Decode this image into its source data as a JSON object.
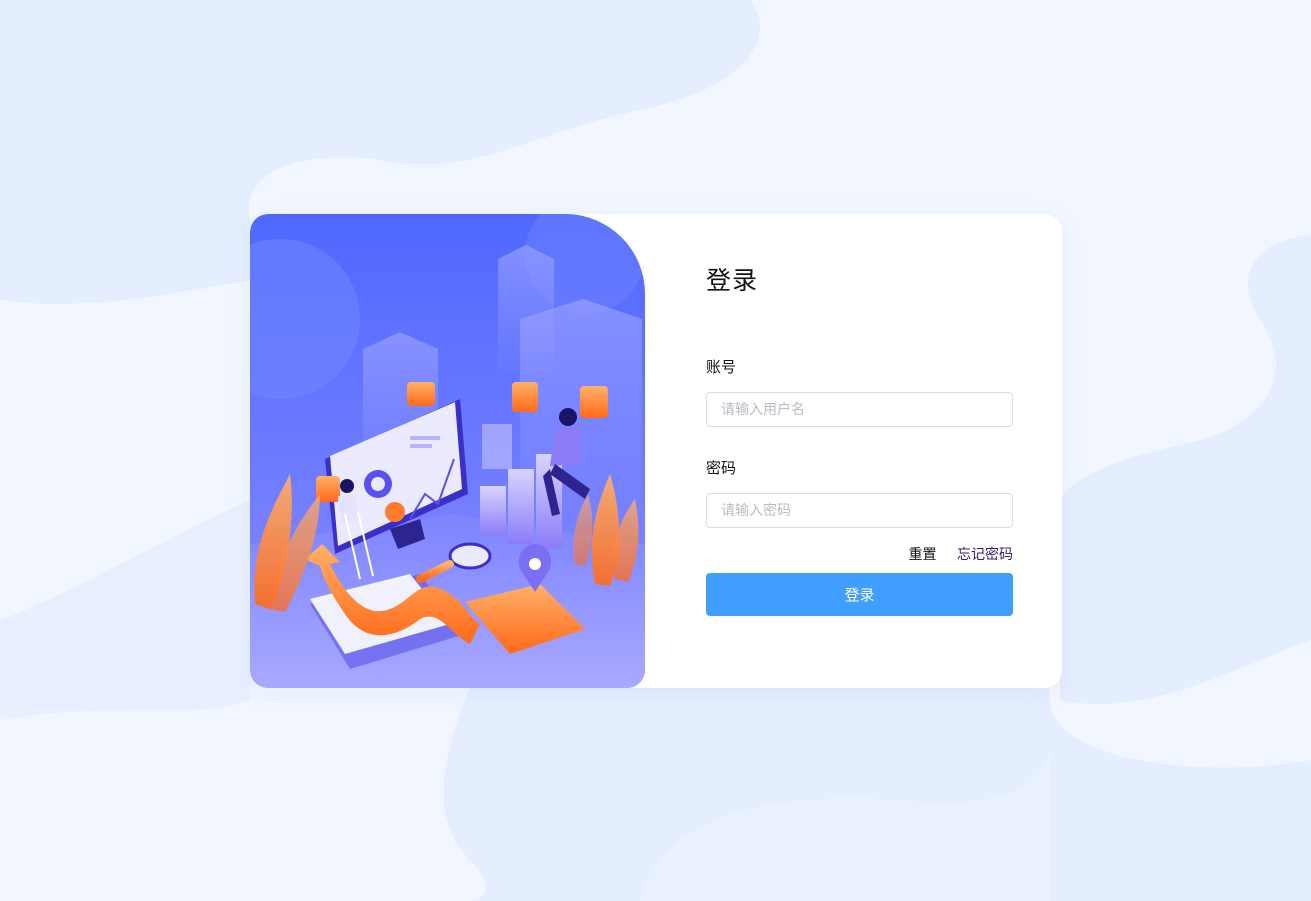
{
  "login": {
    "title": "登录",
    "account_label": "账号",
    "account_placeholder": "请输入用户名",
    "account_value": "",
    "password_label": "密码",
    "password_placeholder": "请输入密码",
    "password_value": "",
    "reset_label": "重置",
    "forgot_label": "忘记密码",
    "submit_label": "登录"
  },
  "colors": {
    "page_background": "#eef4fe",
    "illustration_gradient_top": "#5068ff",
    "button_primary": "#409eff",
    "forgot_link": "#3a1a6e"
  },
  "illustration": {
    "icon": "data-analytics-illustration"
  }
}
